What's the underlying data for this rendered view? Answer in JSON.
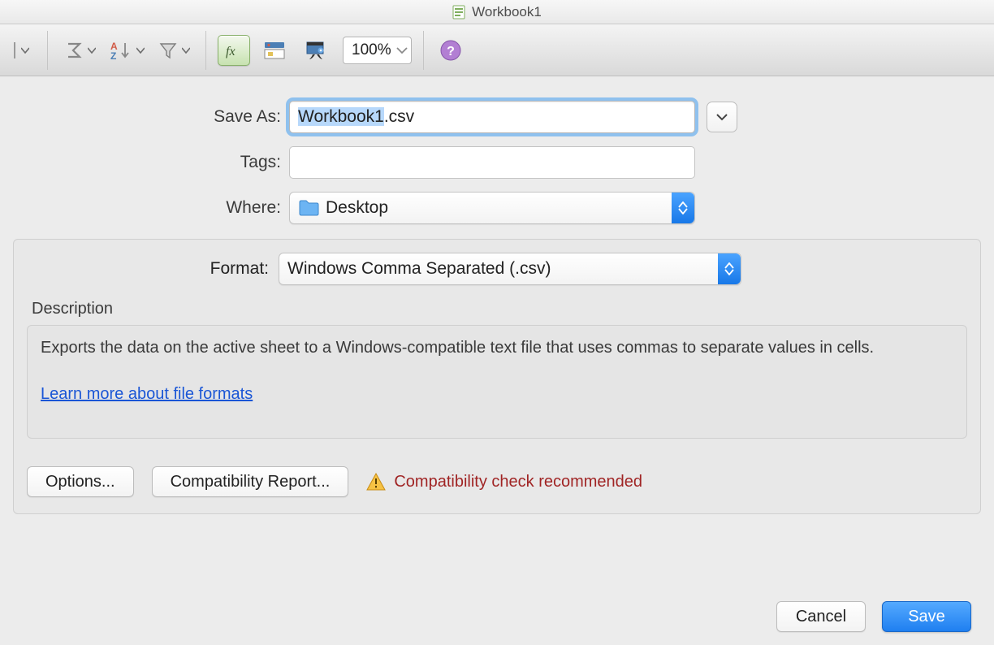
{
  "title": "Workbook1",
  "toolbar": {
    "zoom": "100%"
  },
  "saveas": {
    "label": "Save As:",
    "filename_base": "Workbook1",
    "filename_ext": ".csv"
  },
  "tags": {
    "label": "Tags:"
  },
  "where": {
    "label": "Where:",
    "value": "Desktop"
  },
  "format": {
    "label": "Format:",
    "value": "Windows Comma Separated (.csv)"
  },
  "description": {
    "title": "Description",
    "text": "Exports the data on the active sheet to a Windows-compatible text file that uses commas to separate values in cells.",
    "link": "Learn more about file formats"
  },
  "buttons": {
    "options": "Options...",
    "compat_report": "Compatibility Report...",
    "compat_msg": "Compatibility check recommended",
    "cancel": "Cancel",
    "save": "Save"
  }
}
